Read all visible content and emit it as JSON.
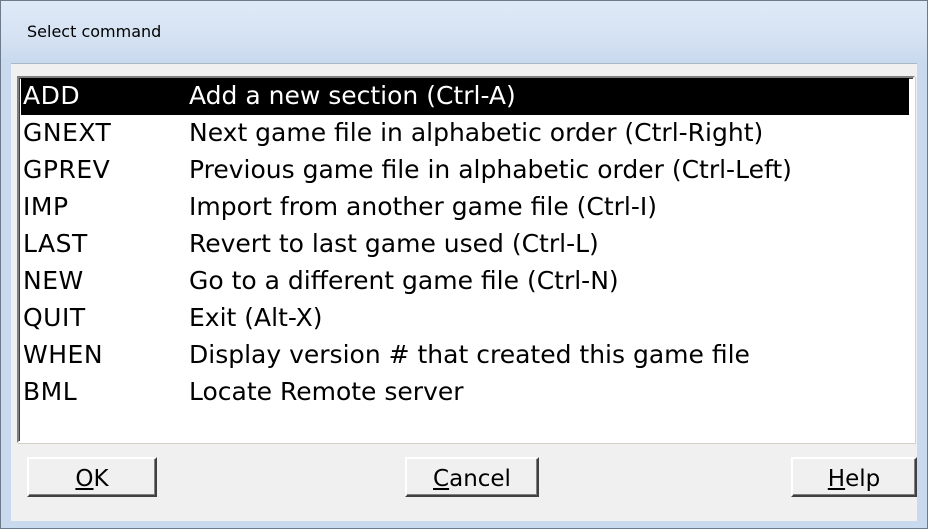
{
  "window": {
    "title": "Select command"
  },
  "commands": [
    {
      "cmd": "ADD",
      "desc": "Add a new section (Ctrl-A)",
      "selected": true
    },
    {
      "cmd": "GNEXT",
      "desc": "Next game file in alphabetic order (Ctrl-Right)",
      "selected": false
    },
    {
      "cmd": "GPREV",
      "desc": "Previous game file in alphabetic order (Ctrl-Left)",
      "selected": false
    },
    {
      "cmd": "IMP",
      "desc": "Import from another game file (Ctrl-I)",
      "selected": false
    },
    {
      "cmd": "LAST",
      "desc": "Revert to last game used (Ctrl-L)",
      "selected": false
    },
    {
      "cmd": "NEW",
      "desc": "Go to a different game file (Ctrl-N)",
      "selected": false
    },
    {
      "cmd": "QUIT",
      "desc": "Exit (Alt-X)",
      "selected": false
    },
    {
      "cmd": "WHEN",
      "desc": "Display version # that created this game file",
      "selected": false
    },
    {
      "cmd": "BML",
      "desc": "Locate Remote server",
      "selected": false
    }
  ],
  "buttons": {
    "ok": "OK",
    "cancel": "Cancel",
    "help": "Help"
  },
  "colors": {
    "selection_bg": "#000000",
    "selection_fg": "#ffffff",
    "titlebar": "#d3e1f2"
  }
}
